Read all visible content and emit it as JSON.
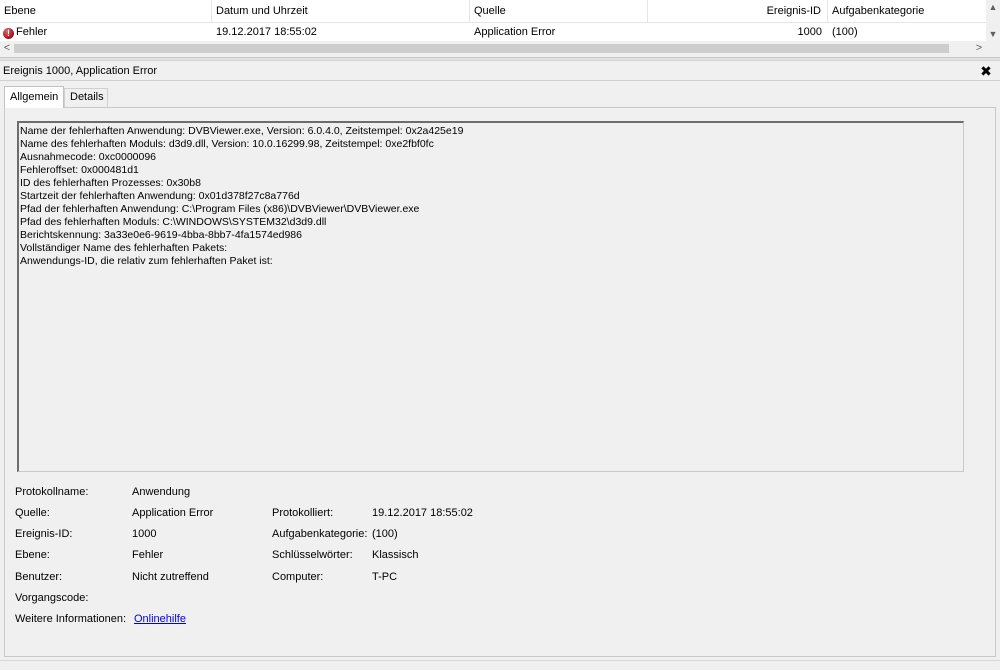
{
  "list": {
    "headers": {
      "level": "Ebene",
      "date": "Datum und Uhrzeit",
      "source": "Quelle",
      "event_id": "Ereignis-ID",
      "task_category": "Aufgabenkategorie"
    },
    "row": {
      "level": "Fehler",
      "date": "19.12.2017 18:55:02",
      "source": "Application Error",
      "event_id": "1000",
      "task_category": "(100)"
    },
    "scroll": {
      "up": "▲",
      "down": "▼",
      "left": "<",
      "right": ">"
    }
  },
  "detail": {
    "title": "Ereignis 1000, Application Error",
    "close": "✖",
    "tabs": [
      "Allgemein",
      "Details"
    ],
    "description": [
      "Name der fehlerhaften Anwendung: DVBViewer.exe, Version: 6.0.4.0, Zeitstempel: 0x2a425e19",
      "Name des fehlerhaften Moduls: d3d9.dll, Version: 10.0.16299.98, Zeitstempel: 0xe2fbf0fc",
      "Ausnahmecode: 0xc0000096",
      "Fehleroffset: 0x000481d1",
      "ID des fehlerhaften Prozesses: 0x30b8",
      "Startzeit der fehlerhaften Anwendung: 0x01d378f27c8a776d",
      "Pfad der fehlerhaften Anwendung: C:\\Program Files (x86)\\DVBViewer\\DVBViewer.exe",
      "Pfad des fehlerhaften Moduls: C:\\WINDOWS\\SYSTEM32\\d3d9.dll",
      "Berichtskennung: 3a33e0e6-9619-4bba-8bb7-4fa1574ed986",
      "Vollständiger Name des fehlerhaften Pakets:",
      "Anwendungs-ID, die relativ zum fehlerhaften Paket ist:"
    ],
    "props": {
      "log_name_label": "Protokollname:",
      "log_name": "Anwendung",
      "source_label": "Quelle:",
      "source": "Application Error",
      "logged_label": "Protokolliert:",
      "logged": "19.12.2017 18:55:02",
      "event_id_label": "Ereignis-ID:",
      "event_id": "1000",
      "task_label": "Aufgabenkategorie:",
      "task": "(100)",
      "level_label": "Ebene:",
      "level": "Fehler",
      "keywords_label": "Schlüsselwörter:",
      "keywords": "Klassisch",
      "user_label": "Benutzer:",
      "user": "Nicht zutreffend",
      "computer_label": "Computer:",
      "computer": "T-PC",
      "opcode_label": "Vorgangscode:",
      "opcode": "",
      "more_info_label": "Weitere Informationen:",
      "more_info_link": "Onlinehilfe"
    }
  },
  "colors": {
    "error_icon": "#a01020",
    "link": "#0000ee",
    "background": "#f0f0f0"
  }
}
